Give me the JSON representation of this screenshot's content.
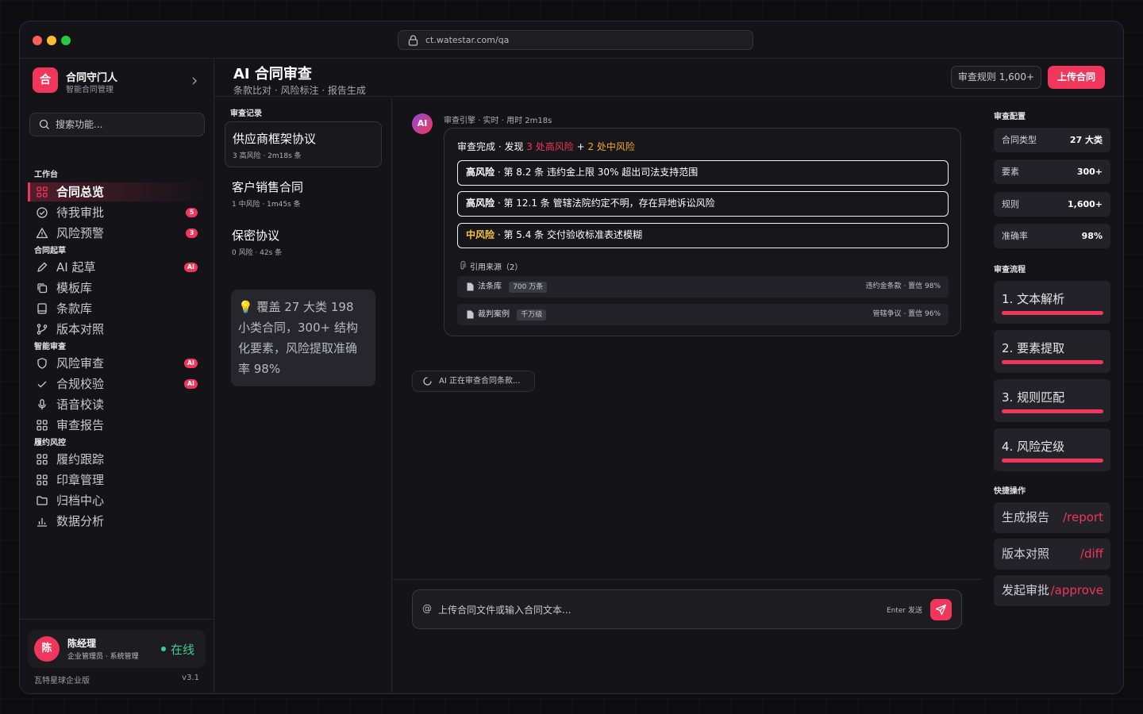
{
  "browser": {
    "url": "ct.watestar.com/qa"
  },
  "brand": {
    "logo": "合",
    "name": "合同守门人",
    "subtitle": "智能合同管理"
  },
  "search": {
    "placeholder": "搜索功能..."
  },
  "nav": {
    "sections": [
      {
        "label": "工作台",
        "items": [
          {
            "label": "合同总览",
            "icon": "grid-icon",
            "active": true
          },
          {
            "label": "待我审批",
            "icon": "check-circle-icon",
            "badge": "5"
          },
          {
            "label": "风险预警",
            "icon": "warning-icon",
            "badge": "3"
          }
        ]
      },
      {
        "label": "合同起草",
        "items": [
          {
            "label": "AI 起草",
            "icon": "pen-icon",
            "badge": "AI"
          },
          {
            "label": "模板库",
            "icon": "copy-icon"
          },
          {
            "label": "条款库",
            "icon": "book-icon"
          },
          {
            "label": "版本对照",
            "icon": "git-compare-icon"
          }
        ]
      },
      {
        "label": "智能审查",
        "items": [
          {
            "label": "风险审查",
            "icon": "shield-icon",
            "badge": "AI"
          },
          {
            "label": "合规校验",
            "icon": "check-icon",
            "badge": "AI"
          },
          {
            "label": "语音校读",
            "icon": "mic-icon"
          },
          {
            "label": "审查报告",
            "icon": "grid-icon"
          }
        ]
      },
      {
        "label": "履约风控",
        "items": [
          {
            "label": "履约跟踪",
            "icon": "grid-icon"
          },
          {
            "label": "印章管理",
            "icon": "grid-icon"
          },
          {
            "label": "归档中心",
            "icon": "folder-icon"
          },
          {
            "label": "数据分析",
            "icon": "bar-chart-icon"
          }
        ]
      }
    ]
  },
  "user": {
    "avatar": "陈",
    "name": "陈经理",
    "role": "企业管理员 · 系统管理",
    "status": "在线"
  },
  "footer": {
    "edition": "瓦特星球企业版",
    "version": "v3.1"
  },
  "header": {
    "title": "AI 合同审查",
    "subtitle": "条款比对 · 风险标注 · 报告生成",
    "rules_button": "审查规则 1,600+",
    "upload_button": "上传合同"
  },
  "history": {
    "label": "审查记录",
    "items": [
      {
        "title": "供应商框架协议",
        "meta": "3 高风险 · 2m18s 条"
      },
      {
        "title": "客户销售合同",
        "meta": "1 中风险 · 1m45s 条"
      },
      {
        "title": "保密协议",
        "meta": "0 风险 · 42s 条"
      }
    ],
    "tip": "覆盖 27 大类 198 小类合同，300+ 结构化要素，风险提取准确率 98%",
    "tip_icon": "💡"
  },
  "message": {
    "avatar": "AI",
    "meta": "审查引擎 · 实时 · 用时 2m18s",
    "summary": {
      "prefix": "审查完成 · 发现",
      "high": "3 处高风险",
      "plus": "+",
      "mid": "2 处中风险"
    },
    "risks": [
      {
        "level": "高风险",
        "text": " · 第 8.2 条 违约金上限 30% 超出司法支持范围",
        "kind": "high"
      },
      {
        "level": "高风险",
        "text": " · 第 12.1 条 管辖法院约定不明，存在异地诉讼风险",
        "kind": "high"
      },
      {
        "level": "中风险",
        "text": " · 第 5.4 条 交付验收标准表述模糊",
        "kind": "mid"
      }
    ],
    "sources_label": "引用来源（2）",
    "sources": [
      {
        "name": "法条库",
        "tag": "700 万条",
        "detail": "违约金条款 · 置信 98%"
      },
      {
        "name": "裁判案例",
        "tag": "千万级",
        "detail": "管辖争议 · 置信 96%"
      }
    ]
  },
  "typing": "AI 正在审查合同条款...",
  "composer": {
    "at": "@",
    "placeholder": "上传合同文件或输入合同文本...",
    "hint": "Enter 发送"
  },
  "config": {
    "label": "审查配置",
    "rows": [
      {
        "key": "合同类型",
        "value": "27 大类"
      },
      {
        "key": "要素",
        "value": "300+"
      },
      {
        "key": "规则",
        "value": "1,600+"
      },
      {
        "key": "准确率",
        "value": "98%"
      }
    ]
  },
  "process": {
    "label": "审查流程",
    "steps": [
      {
        "label": "1. 文本解析",
        "progress": 1.0
      },
      {
        "label": "2. 要素提取",
        "progress": 1.0
      },
      {
        "label": "3. 规则匹配",
        "progress": 1.0
      },
      {
        "label": "4. 风险定级",
        "progress": 1.0
      }
    ]
  },
  "quick": {
    "label": "快捷操作",
    "actions": [
      {
        "label": "生成报告",
        "cmd": "/report"
      },
      {
        "label": "版本对照",
        "cmd": "/diff"
      },
      {
        "label": "发起审批",
        "cmd": "/approve"
      }
    ]
  },
  "colors": {
    "accent": "#f0365a",
    "warning": "#f5a623",
    "online": "#3ecf8e",
    "background": "#141418"
  }
}
